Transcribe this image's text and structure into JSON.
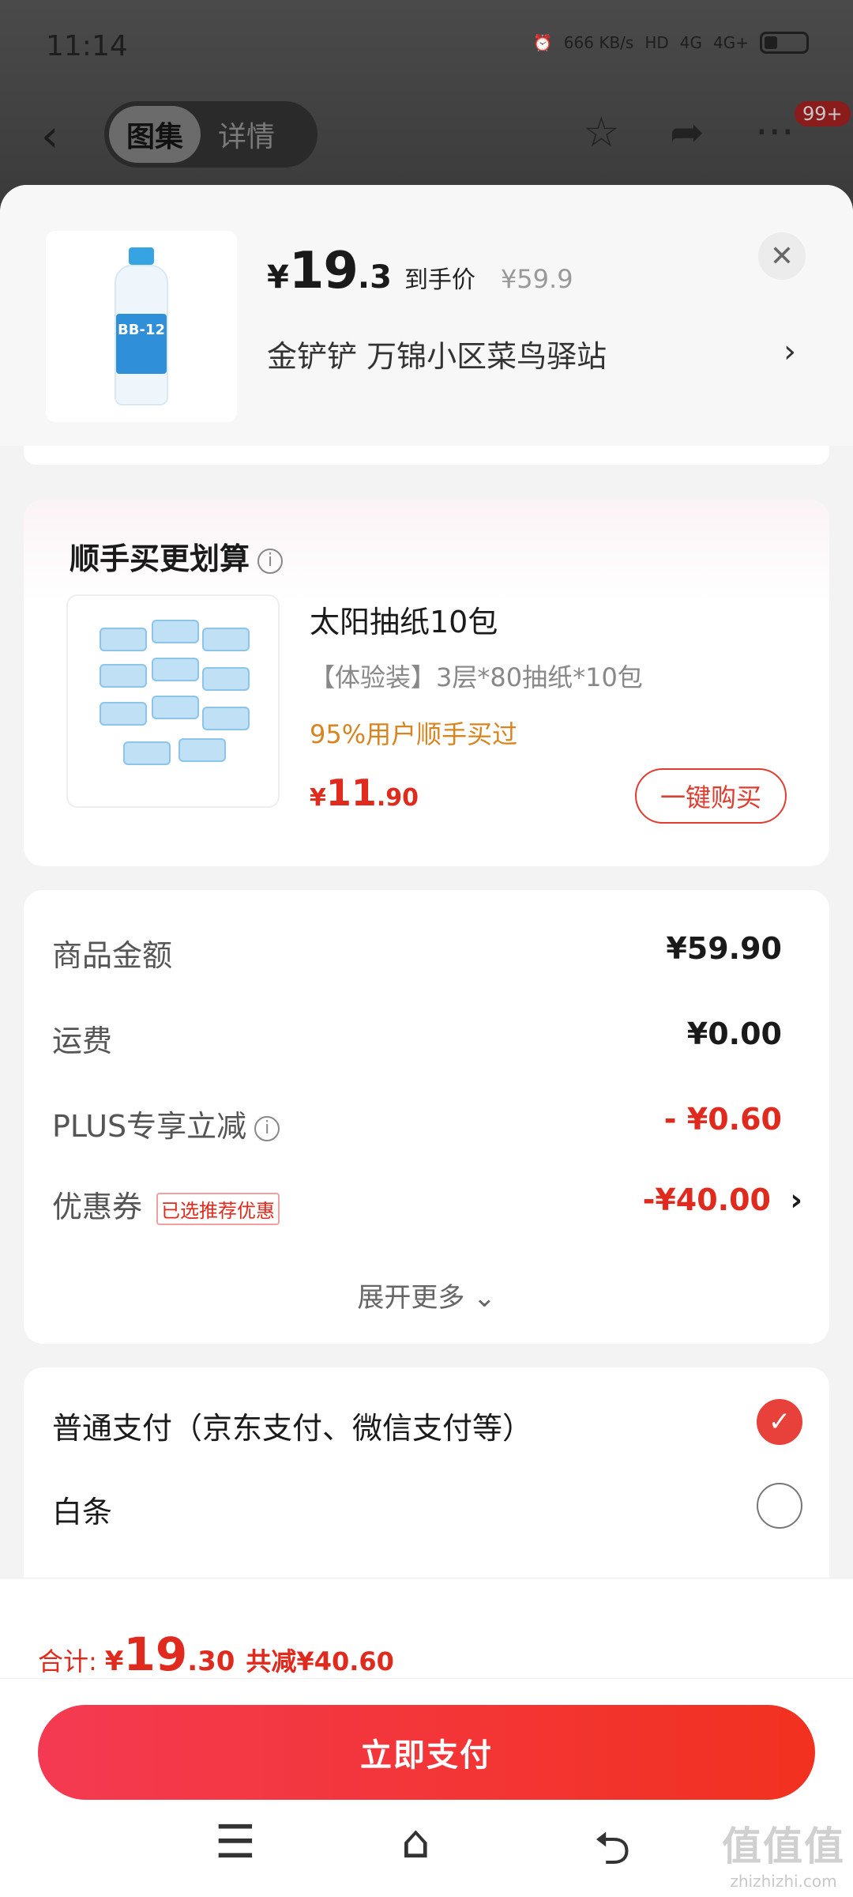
{
  "status_bar": {
    "time": "11:14",
    "net_speed": "666 KB/s",
    "signal_a": "4G",
    "signal_b": "4G+"
  },
  "nav": {
    "tabs": [
      "图集",
      "详情"
    ],
    "more_badge": "99+"
  },
  "product": {
    "currency": "¥",
    "price_int": "19",
    "price_dec": ".3",
    "price_tag": "到手价",
    "original_price": "¥59.9",
    "address": "金铲铲  万锦小区菜鸟驿站",
    "bottle_label": "BB-12"
  },
  "upsell": {
    "title": "顺手买更划算",
    "info": "i",
    "name": "太阳抽纸10包",
    "spec": "【体验装】3层*80抽纸*10包",
    "hint": "95%用户顺手买过",
    "currency": "¥",
    "price_int": "11",
    "price_dec": ".90",
    "buy_label": "一键购买"
  },
  "summary": {
    "rows": [
      {
        "label": "商品金额",
        "value": "¥59.90"
      },
      {
        "label": "运费",
        "value": "¥0.00"
      },
      {
        "label": "PLUS专享立减",
        "value": "- ¥0.60"
      },
      {
        "label": "优惠券",
        "value": "-¥40.00",
        "tag": "已选推荐优惠"
      }
    ],
    "expand_label": "展开更多 ⌄"
  },
  "payment": {
    "options": [
      {
        "label": "普通支付（京东支付、微信支付等）",
        "selected": true
      },
      {
        "label": "白条",
        "selected": false
      }
    ]
  },
  "footer": {
    "total_label": "合计:",
    "currency": "¥",
    "total_int": "19",
    "total_dec": ".30",
    "saved": "共减¥40.60",
    "pay_button": "立即支付"
  },
  "watermark": {
    "big": "值值值",
    "small": "zhizhizhi.com"
  },
  "colors": {
    "accent_red": "#e02a1e",
    "hint_orange": "#d88420",
    "pay_gradient_start": "#f43a52",
    "pay_gradient_end": "#f2311f"
  }
}
